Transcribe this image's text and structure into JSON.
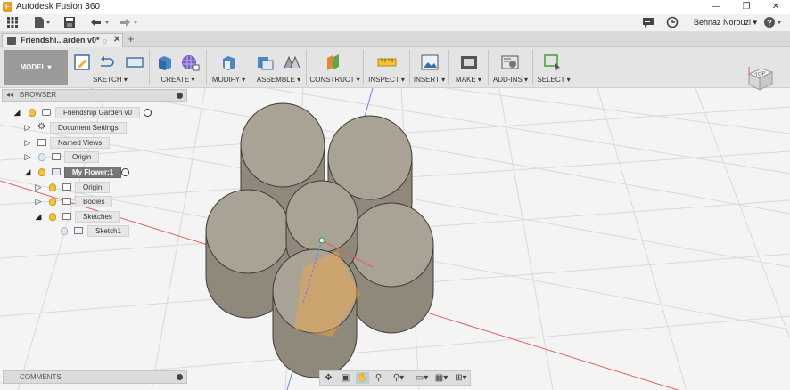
{
  "window": {
    "app_logo": "F",
    "title": "Autodesk Fusion 360",
    "minimize": "—",
    "maximize": "❐",
    "close": "✕"
  },
  "quickbar": {
    "grid_icon": "grid-icon",
    "file_icon": "file-icon",
    "save_icon": "save-icon",
    "undo_icon": "undo-icon",
    "redo_icon": "redo-icon",
    "comment_icon": "comment-icon",
    "clock_icon": "clock-icon",
    "user_name": "Behnaz Norouzi ▾",
    "help_icon": "help-icon",
    "help_label": "?"
  },
  "tabs": {
    "doc_tab_label": "Friendshi...arden v0*",
    "add_tab": "+"
  },
  "toolbar": {
    "workspace": "MODEL ▾",
    "groups": [
      {
        "label": "SKETCH ▾"
      },
      {
        "label": "CREATE ▾"
      },
      {
        "label": "MODIFY ▾"
      },
      {
        "label": "ASSEMBLE ▾"
      },
      {
        "label": "CONSTRUCT ▾"
      },
      {
        "label": "INSPECT ▾"
      },
      {
        "label": "INSERT ▾"
      },
      {
        "label": "MAKE ▾"
      },
      {
        "label": "ADD-INS ▾"
      },
      {
        "label": "SELECT ▾"
      }
    ]
  },
  "browser": {
    "title": "BROWSER",
    "collapse_icon": "◂◂",
    "nodes": [
      {
        "label": "Friendship Garden v0"
      },
      {
        "label": "Document Settings"
      },
      {
        "label": "Named Views"
      },
      {
        "label": "Origin"
      },
      {
        "label": "My Flower:1"
      },
      {
        "label": "Origin"
      },
      {
        "label": "Bodies"
      },
      {
        "label": "Sketches"
      },
      {
        "label": "Sketch1"
      }
    ]
  },
  "comments": {
    "title": "COMMENTS"
  },
  "viewcube": {
    "face": "TOP"
  },
  "colors": {
    "solid_top": "#a9a395",
    "solid_side": "#8f897b",
    "selection": "#f5a640",
    "axis_red": "#e06060",
    "axis_blue": "#6f7ff0"
  },
  "navbar": {
    "icons": [
      "orbit-icon",
      "look-at-icon",
      "pan-icon",
      "zoom-icon",
      "fit-icon",
      "display-icon",
      "grid-icon",
      "viewports-icon"
    ]
  }
}
